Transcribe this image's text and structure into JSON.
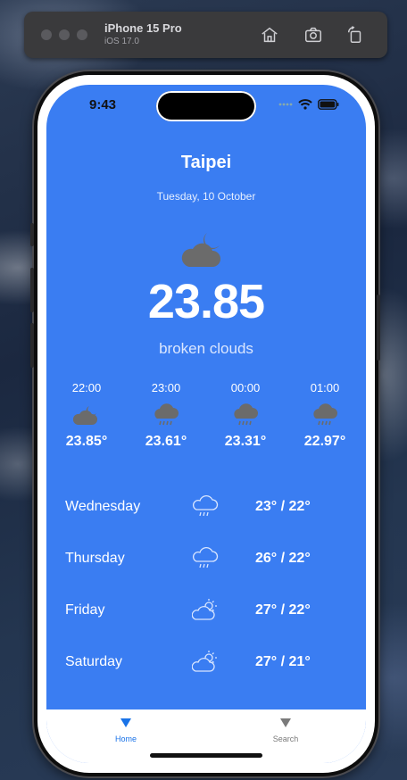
{
  "simulator": {
    "device_name": "iPhone 15 Pro",
    "os_version": "iOS 17.0"
  },
  "status_bar": {
    "time": "9:43"
  },
  "current": {
    "city": "Taipei",
    "date": "Tuesday, 10 October",
    "icon": "cloud-moon-icon",
    "temperature": "23.85",
    "description": "broken clouds"
  },
  "hourly": [
    {
      "time": "22:00",
      "icon": "cloud-moon-icon",
      "temp": "23.85°"
    },
    {
      "time": "23:00",
      "icon": "cloud-rain-icon",
      "temp": "23.61°"
    },
    {
      "time": "00:00",
      "icon": "cloud-rain-icon",
      "temp": "23.31°"
    },
    {
      "time": "01:00",
      "icon": "cloud-rain-icon",
      "temp": "22.97°"
    }
  ],
  "daily": [
    {
      "day": "Wednesday",
      "icon": "cloud-rain-icon",
      "range": "23° / 22°"
    },
    {
      "day": "Thursday",
      "icon": "cloud-rain-icon",
      "range": "26° / 22°"
    },
    {
      "day": "Friday",
      "icon": "cloud-sun-icon",
      "range": "27° / 22°"
    },
    {
      "day": "Saturday",
      "icon": "cloud-sun-icon",
      "range": "27° / 21°"
    }
  ],
  "tabs": [
    {
      "label": "Home",
      "icon": "triangle-down-icon",
      "active": true
    },
    {
      "label": "Search",
      "icon": "triangle-down-icon",
      "active": false
    }
  ],
  "colors": {
    "background": "#3a7df2",
    "active_tab": "#1a73e8",
    "inactive_tab": "#7a7a7a"
  }
}
